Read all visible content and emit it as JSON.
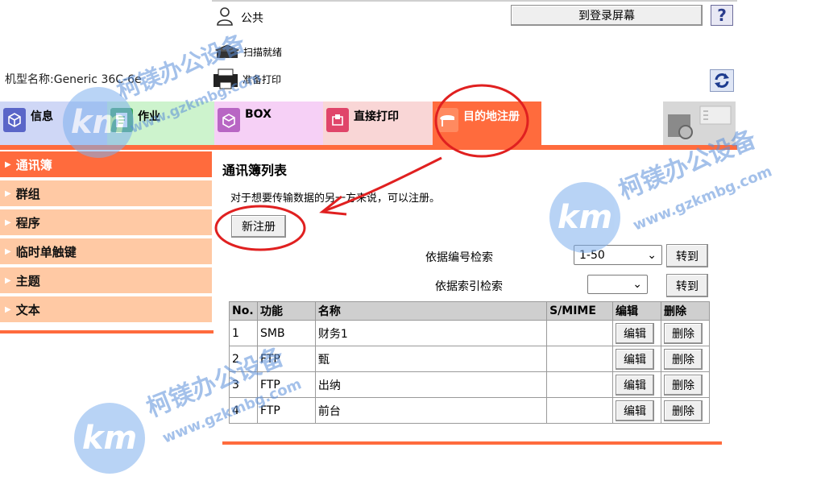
{
  "header": {
    "user_label": "公共",
    "login_button": "到登录屏幕",
    "help_button": "?",
    "scan_status": "扫描就绪",
    "print_status": "准备打印",
    "model_name": "机型名称:Generic 36C-6e",
    "user_icon": "user-icon",
    "refresh_icon": "refresh-icon"
  },
  "tabs": [
    {
      "label": "信息",
      "icon": "info-icon",
      "color": "#cfd7f6"
    },
    {
      "label": "作业",
      "icon": "job-icon",
      "color": "#cdf3cd"
    },
    {
      "label": "BOX",
      "icon": "box-icon",
      "color": "#f6d0f6"
    },
    {
      "label": "直接打印",
      "icon": "print-icon",
      "color": "#f9d6d6"
    },
    {
      "label": "目的地注册",
      "icon": "destination-icon",
      "color": "#ff6b3d",
      "active": true
    }
  ],
  "sidebar": {
    "items": [
      {
        "label": "通讯簿",
        "active": true
      },
      {
        "label": "群组"
      },
      {
        "label": "程序"
      },
      {
        "label": "临时单触键"
      },
      {
        "label": "主题"
      },
      {
        "label": "文本"
      }
    ]
  },
  "main": {
    "title": "通讯簿列表",
    "description": "对于想要传输数据的另一方来说，可以注册。",
    "new_button": "新注册",
    "search_by_number": {
      "label": "依据编号检索",
      "selected": "1-50",
      "button": "转到"
    },
    "search_by_index": {
      "label": "依据索引检索",
      "selected": "",
      "button": "转到"
    },
    "table": {
      "headers": [
        "No.",
        "功能",
        "名称",
        "S/MIME",
        "编辑",
        "删除"
      ],
      "rows": [
        {
          "no": "1",
          "func": "SMB",
          "name": "财务1",
          "smime": "",
          "edit": "编辑",
          "del": "删除"
        },
        {
          "no": "2",
          "func": "FTP",
          "name": "甄",
          "smime": "",
          "edit": "编辑",
          "del": "删除"
        },
        {
          "no": "3",
          "func": "FTP",
          "name": "出纳",
          "smime": "",
          "edit": "编辑",
          "del": "删除"
        },
        {
          "no": "4",
          "func": "FTP",
          "name": "前台",
          "smime": "",
          "edit": "编辑",
          "del": "删除"
        }
      ]
    }
  },
  "watermark": {
    "brand": "柯镁办公设备",
    "url": "www.gzkmbg.com",
    "logo": "km"
  },
  "colors": {
    "accent": "#ff6b3d",
    "sidebar": "#ffc9a4",
    "annotation": "#e02020"
  }
}
